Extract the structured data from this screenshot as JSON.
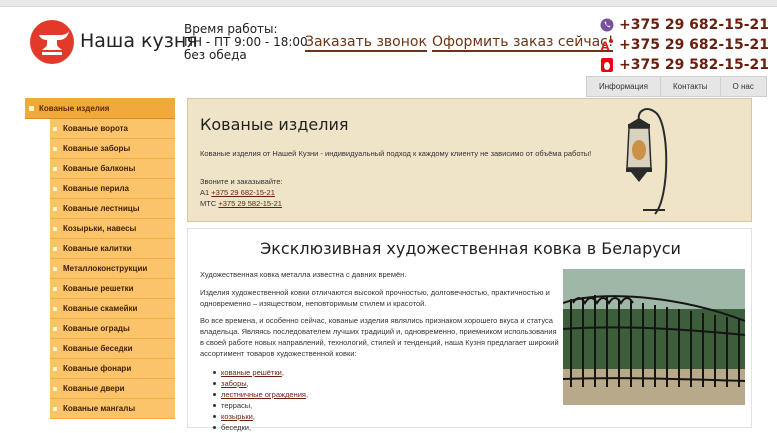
{
  "header": {
    "brand": "Наша кузня",
    "hours_line1": "Время работы:",
    "hours_line2": "ПН - ПТ 9:00 - 18:00",
    "hours_line3": "без обеда",
    "callback_link": "Заказать звонок",
    "order_link": "Оформить заказ сейчас!",
    "phones": [
      {
        "icon": "viber-icon",
        "number": "+375 29 682-15-21"
      },
      {
        "icon": "a1-icon",
        "number": "+375 29 682-15-21"
      },
      {
        "icon": "mts-icon",
        "number": "+375 29 582-15-21"
      }
    ]
  },
  "topnav": [
    "Информация",
    "Контакты",
    "О нас"
  ],
  "sidebar": {
    "head": "Кованые изделия",
    "items": [
      "Кованые ворота",
      "Кованые заборы",
      "Кованые балконы",
      "Кованые перила",
      "Кованые лестницы",
      "Козырьки, навесы",
      "Кованые калитки",
      "Металлоконструкции",
      "Кованые решетки",
      "Кованые скамейки",
      "Кованые ограды",
      "Кованые беседки",
      "Кованые фонари",
      "Кованые двери",
      "Кованые мангалы"
    ]
  },
  "banner": {
    "title": "Кованые изделия",
    "text": "Кованые изделия от Нашей Кузни - индивидуальный подход к каждому клиенту не зависимо от объёма работы!",
    "call_label": "Звоните и заказывайте:",
    "a1_prefix": "А1",
    "a1_number": "+375 29 682-15-21",
    "mts_prefix": "МТС",
    "mts_number": "+375 29 582-15-21"
  },
  "content": {
    "title": "Эксклюзивная художественная ковка в Беларуси",
    "p1": "Художественная ковка металла известна с давних времён.",
    "p2": "Изделия художественной ковки отличаются высокой прочностью, долговечностью, практичностью и одновременно – изяществом, неповторимым стилем и красотой.",
    "p3": "Во все времена, и особенно сейчас, кованые изделия являлись признаком хорошего вкуса и статуса владельца. Являясь последователем лучших традиций и, одновременно, приемником использования в своей работе новых направлений, технологий, стилей и тенденций, наша Кузня предлагает широкий ассортимент товаров художественной ковки:",
    "bullets": [
      {
        "text": "кованые решётки",
        "link": true,
        "suffix": ","
      },
      {
        "text": "заборы",
        "link": true,
        "suffix": ","
      },
      {
        "text": "лестничные ограждения",
        "link": true,
        "suffix": ","
      },
      {
        "text": "террасы,",
        "link": false,
        "suffix": ""
      },
      {
        "text": "козырьки",
        "link": true,
        "suffix": ","
      },
      {
        "text": "беседки,",
        "link": false,
        "suffix": ""
      }
    ]
  }
}
